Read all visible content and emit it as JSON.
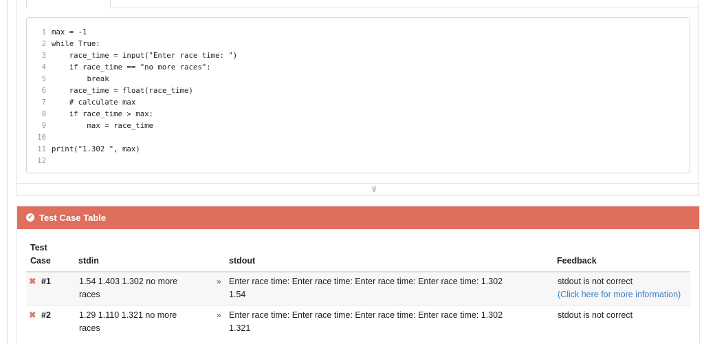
{
  "code_editor": {
    "lines": [
      {
        "num": "1",
        "text": "max = -1"
      },
      {
        "num": "2",
        "text": "while True:"
      },
      {
        "num": "3",
        "text": "    race_time = input(\"Enter race time: \")"
      },
      {
        "num": "4",
        "text": "    if race_time == \"no more races\":"
      },
      {
        "num": "5",
        "text": "        break"
      },
      {
        "num": "6",
        "text": "    race_time = float(race_time)"
      },
      {
        "num": "7",
        "text": "    # calculate max"
      },
      {
        "num": "8",
        "text": "    if race_time > max:"
      },
      {
        "num": "9",
        "text": "        max = race_time"
      },
      {
        "num": "10",
        "text": ""
      },
      {
        "num": "11",
        "text": "print(\"1.302 \", max)"
      },
      {
        "num": "12",
        "text": ""
      }
    ]
  },
  "expander": {
    "icon": "double-chevron-down-icon",
    "glyph": "≫"
  },
  "test_case_table": {
    "title": "Test Case Table",
    "header_color": "#df6e5c",
    "header_icon_glyph": "✔",
    "columns": {
      "test_case_line1": "Test",
      "test_case_line2": "Case",
      "stdin": "stdin",
      "stdout": "stdout",
      "feedback": "Feedback"
    },
    "rows": [
      {
        "status_icon": "✖",
        "case_id": "#1",
        "stdin_line1": "1.54 1.403 1.302 no more",
        "stdin_line2": "races",
        "stdout_arrow": "»",
        "stdout_line1": "Enter race time: Enter race time: Enter race time: Enter race time: 1.302",
        "stdout_line2": "1.54",
        "feedback": "stdout is not correct",
        "feedback_link": "(Click here for more information)"
      },
      {
        "status_icon": "✖",
        "case_id": "#2",
        "stdin_line1": "1.29 1.110 1.321 no more",
        "stdin_line2": "races",
        "stdout_arrow": "»",
        "stdout_line1": "Enter race time: Enter race time: Enter race time: Enter race time: 1.302",
        "stdout_line2": "1.321",
        "feedback": "stdout is not correct"
      }
    ]
  }
}
